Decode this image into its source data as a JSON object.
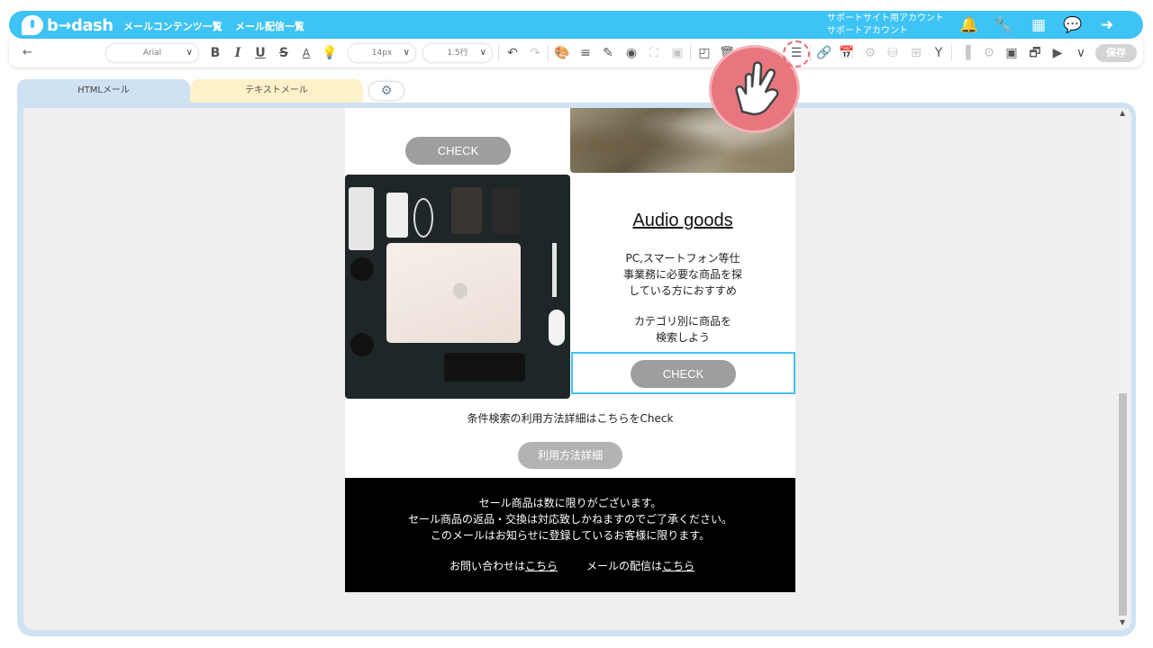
{
  "app": {
    "logo_text": "b→dash",
    "brand_color": "#3ec3f5"
  },
  "header": {
    "nav": [
      "メールコンテンツ一覧",
      "メール配信一覧"
    ],
    "account_line1": "サポートサイト用アカウント",
    "account_line2": "サポートアカウント",
    "icons": [
      "bell-icon",
      "wrench-icon",
      "grid-icon",
      "chat-bubble-icon",
      "logout-icon"
    ]
  },
  "toolbar": {
    "back": "←",
    "font_family": "Arial",
    "font_size": "14px",
    "line_height": "1.5行",
    "save_label": "保存"
  },
  "tabs": {
    "html": "HTMLメール",
    "text": "テキストメール"
  },
  "email": {
    "check_top": "CHECK",
    "audio_title": "Audio goods",
    "desc1": [
      "PC,スマートフォン等仕",
      "事業務に必要な商品を探",
      "している方におすすめ"
    ],
    "desc2": [
      "カテゴリ別に商品を",
      "検索しよう"
    ],
    "check_selected": "CHECK",
    "search_note": "条件検索の利用方法詳細はこちらをCheck",
    "detail_button": "利用方法詳細",
    "footer": {
      "lines": [
        "セール商品は数に限りがございます。",
        "セール商品の返品・交換は対応致しかねますのでご了承ください。",
        "このメールはお知らせに登録しているお客様に限ります。"
      ],
      "contact_prefix": "お問い合わせは",
      "contact_link": "こちら",
      "delivery_prefix": "メールの配信は",
      "delivery_link": "こちら"
    }
  }
}
